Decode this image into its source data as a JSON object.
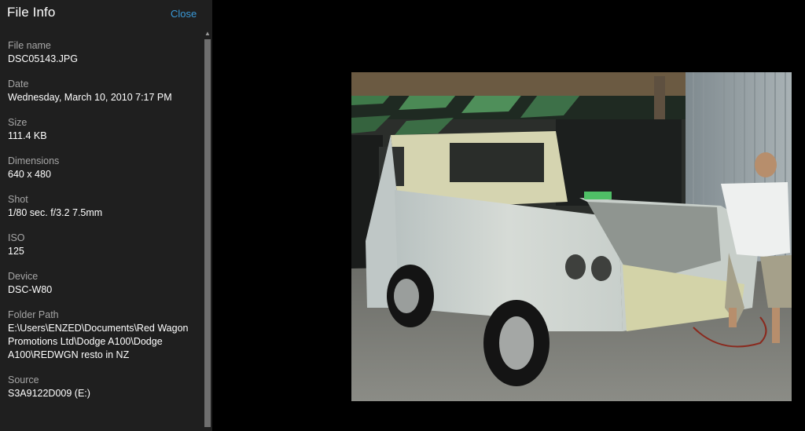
{
  "panel": {
    "title": "File Info",
    "close_label": "Close"
  },
  "fields": [
    {
      "label": "File name",
      "value": "DSC05143.JPG"
    },
    {
      "label": "Date",
      "value": "Wednesday, March 10, 2010 7:17 PM"
    },
    {
      "label": "Size",
      "value": "111.4 KB"
    },
    {
      "label": "Dimensions",
      "value": "640 x 480"
    },
    {
      "label": "Shot",
      "value": "1/80 sec. f/3.2 7.5mm"
    },
    {
      "label": "ISO",
      "value": "125"
    },
    {
      "label": "Device",
      "value": "DSC-W80"
    },
    {
      "label": "Folder Path",
      "value": "E:\\Users\\ENZED\\Documents\\Red Wagon Promotions Ltd\\Dodge A100\\Dodge A100\\REDWGN resto in NZ"
    },
    {
      "label": "Source",
      "value": "S3A9122D009 (E:)"
    }
  ],
  "colors": {
    "panel_bg": "#1f1f1f",
    "accent": "#3a9ad9",
    "label": "#a6a6a6"
  },
  "photo": {
    "icon": "photo-of-pickup-truck-in-carport"
  }
}
